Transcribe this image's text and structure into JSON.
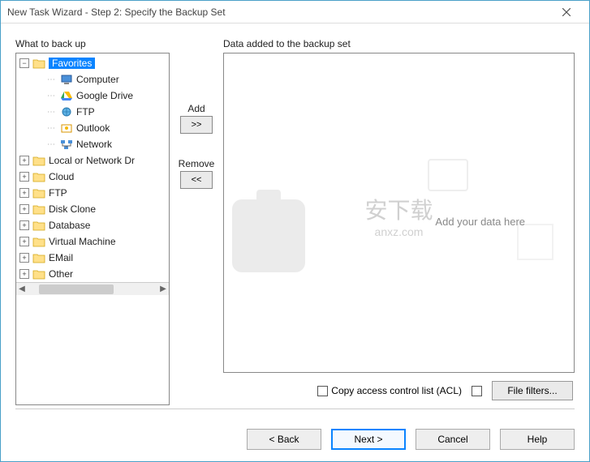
{
  "window": {
    "title": "New Task Wizard - Step 2: Specify the Backup Set"
  },
  "labels": {
    "left": "What to back up",
    "right": "Data added to the backup set",
    "placeholder": "Add your data here"
  },
  "tree": {
    "root": {
      "label": "Favorites",
      "children": [
        {
          "label": "Computer",
          "icon": "computer"
        },
        {
          "label": "Google Drive",
          "icon": "gdrive"
        },
        {
          "label": "FTP",
          "icon": "ftp"
        },
        {
          "label": "Outlook",
          "icon": "outlook"
        },
        {
          "label": "Network",
          "icon": "network"
        }
      ]
    },
    "siblings": [
      {
        "label": "Local or Network Dr"
      },
      {
        "label": "Cloud"
      },
      {
        "label": "FTP"
      },
      {
        "label": "Disk Clone"
      },
      {
        "label": "Database"
      },
      {
        "label": "Virtual Machine"
      },
      {
        "label": "EMail"
      },
      {
        "label": "Other"
      }
    ]
  },
  "middle": {
    "add_label": "Add",
    "add_symbol": ">>",
    "remove_label": "Remove",
    "remove_symbol": "<<"
  },
  "options": {
    "acl_label": "Copy access control list (ACL)",
    "filters_label": "File filters..."
  },
  "footer": {
    "back": "< Back",
    "next": "Next >",
    "cancel": "Cancel",
    "help": "Help"
  }
}
